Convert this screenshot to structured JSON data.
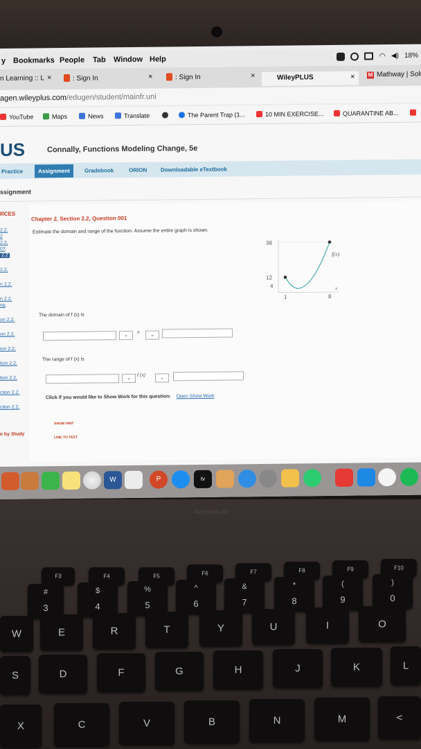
{
  "menubar": {
    "items": [
      "y",
      "Bookmarks",
      "People",
      "Tab",
      "Window",
      "Help"
    ],
    "battery": "18%"
  },
  "tabs": [
    {
      "label": "n Learning :: L",
      "icon": "none"
    },
    {
      "label": ": Sign In",
      "icon": "wiley-icon"
    },
    {
      "label": ": Sign In",
      "icon": "wiley-icon"
    },
    {
      "label": "WileyPLUS",
      "icon": "none"
    },
    {
      "label": "Mathway | Solu",
      "icon": "mathway-icon"
    }
  ],
  "url": {
    "host": "agen.wileyplus.com",
    "path": "/edugen/student/mainfr.uni"
  },
  "bookmarks": [
    {
      "label": "YouTube",
      "color": "#e33"
    },
    {
      "label": "Maps",
      "color": "#3a9c45"
    },
    {
      "label": "News",
      "color": "#3b73d6"
    },
    {
      "label": "Translate",
      "color": "#3b73d6"
    },
    {
      "label": "",
      "color": "#333"
    },
    {
      "label": "The Parent Trap (1...",
      "color": "#1a73e8"
    },
    {
      "label": "10 MIN EXERCISE...",
      "color": "#e33"
    },
    {
      "label": "QUARANTINE AB...",
      "color": "#e33"
    }
  ],
  "page": {
    "brand": "US",
    "book_title": "Connally, Functions Modeling Change, 5e",
    "nav": [
      "Practice",
      "Assignment",
      "Gradebook",
      "ORION",
      "Downloadable eTextbook"
    ],
    "crumb": "ssignment",
    "sidebar": {
      "header": "RCES",
      "links": [
        "2.2.",
        "2",
        "2.2.",
        "07",
        "2.2",
        "2.2.",
        "n 2.2.",
        "n 2.2.",
        "ng",
        "on 2.2.",
        "on 2.2.",
        "ion 2.2.",
        "tion 2.2.",
        "tion 2.2.",
        "ction 2.2.",
        "ction 2.2."
      ],
      "study": "e by Study"
    },
    "question": {
      "title": "Chapter 2, Section 2.2, Question 001",
      "text": "Estimate the domain and range of the function. Assume the entire graph is shown.",
      "domain_label": "The domain of f (x) is",
      "range_label": "The range of f (x) is",
      "domain_var": "x",
      "range_var": "f (x)",
      "show_work_text": "Click if you would like to Show Work for this question:",
      "show_work_link": "Open Show Work",
      "show_hint": "SHOW HINT",
      "link_to_text": "LINK TO TEXT"
    },
    "graph": {
      "y_ticks": [
        "38",
        "12",
        "4"
      ],
      "x_ticks": [
        "1",
        "8"
      ],
      "curve_label": "f(x)",
      "x_label": "x"
    }
  },
  "dock_label": "MacBook Air",
  "keys": {
    "fn_labels": [
      "F3",
      "F4",
      "F5",
      "F6",
      "F7",
      "F8",
      "F9",
      "F10"
    ],
    "num_row": [
      {
        "top": "#",
        "bottom": "3"
      },
      {
        "top": "$",
        "bottom": "4"
      },
      {
        "top": "%",
        "bottom": "5"
      },
      {
        "top": "^",
        "bottom": "6"
      },
      {
        "top": "&",
        "bottom": "7"
      },
      {
        "top": "*",
        "bottom": "8"
      },
      {
        "top": "(",
        "bottom": "9"
      },
      {
        "top": ")",
        "bottom": "0"
      }
    ],
    "row_qwerty": [
      "W",
      "E",
      "R",
      "T",
      "Y",
      "U",
      "I",
      "O"
    ],
    "row_asdf": [
      "S",
      "D",
      "F",
      "G",
      "H",
      "J",
      "K",
      "L"
    ],
    "row_zxcv": [
      "X",
      "C",
      "V",
      "B",
      "N",
      "M",
      "<"
    ]
  }
}
